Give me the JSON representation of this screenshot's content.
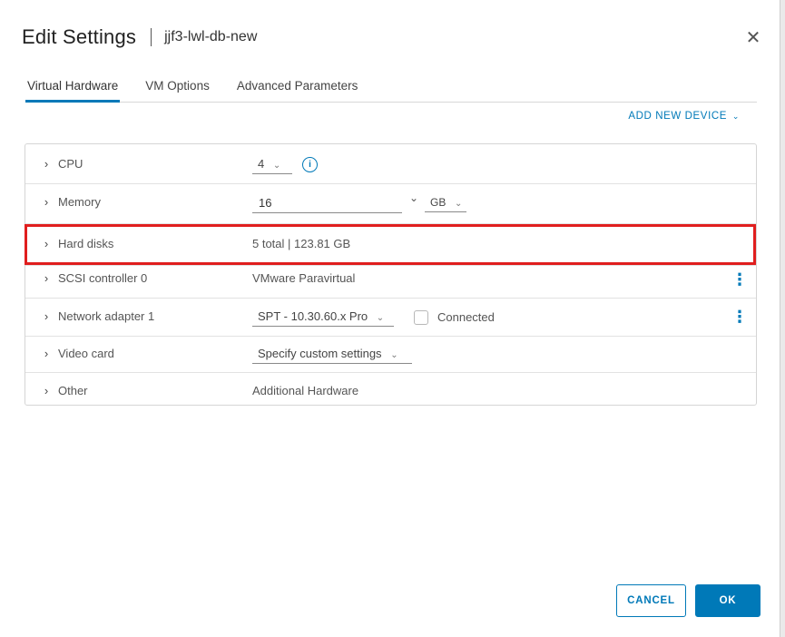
{
  "dialog": {
    "title": "Edit Settings",
    "vm_name": "jjf3-lwl-db-new",
    "close_glyph": "✕"
  },
  "tabs": [
    {
      "label": "Virtual Hardware",
      "active": true
    },
    {
      "label": "VM Options",
      "active": false
    },
    {
      "label": "Advanced Parameters",
      "active": false
    }
  ],
  "add_device": {
    "label": "ADD NEW DEVICE",
    "chevron": "⌄"
  },
  "rows": {
    "cpu": {
      "label": "CPU",
      "value": "4"
    },
    "memory": {
      "label": "Memory",
      "value": "16",
      "unit": "GB"
    },
    "hard_disks": {
      "label": "Hard disks",
      "value": "5 total | 123.81 GB"
    },
    "scsi": {
      "label": "SCSI controller 0",
      "value": "VMware Paravirtual"
    },
    "network": {
      "label": "Network adapter 1",
      "value": "SPT - 10.30.60.x Pro",
      "checkbox_label": "Connected",
      "connected": false
    },
    "video": {
      "label": "Video card",
      "value": "Specify custom settings"
    },
    "other": {
      "label": "Other",
      "value": "Additional Hardware"
    }
  },
  "icons": {
    "expand": "›",
    "dropdown": "⌄",
    "info": "i",
    "kebab": "⋮"
  },
  "colors": {
    "accent": "#0079b8",
    "highlight": "#e01e1e"
  },
  "footer": {
    "cancel_label": "CANCEL",
    "ok_label": "OK"
  }
}
